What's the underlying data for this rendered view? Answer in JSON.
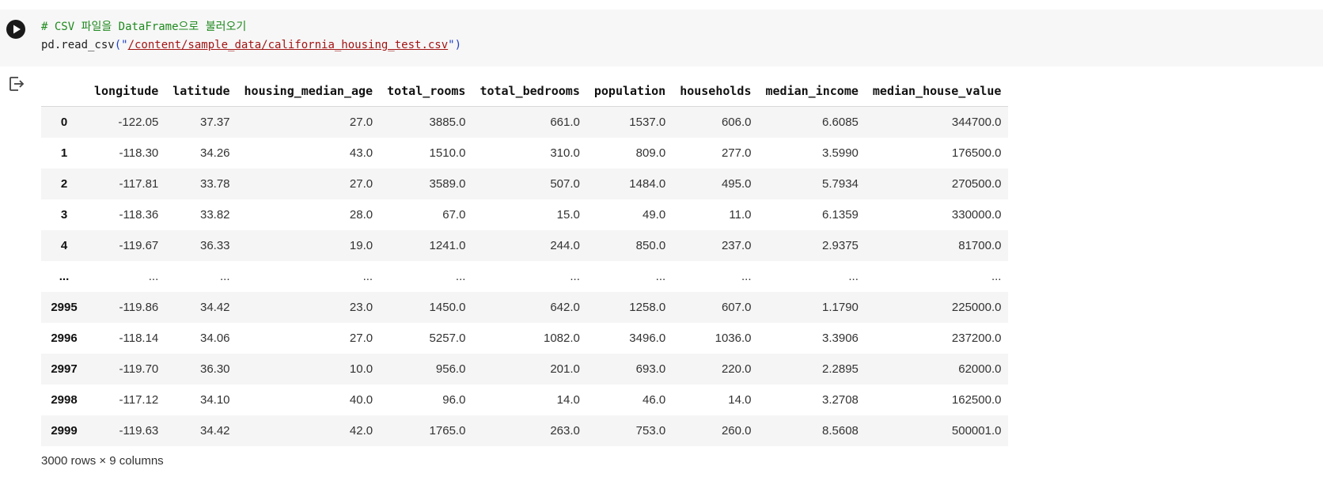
{
  "cell": {
    "code_comment": "# CSV 파일을 DataFrame으로 불러오기",
    "code_call": "pd.read_csv",
    "code_open": "(\"",
    "code_path": "/content/sample_data/california_housing_test.csv",
    "code_close": "\")",
    "run_icon": "play-icon",
    "output_icon": "output-redirect-icon"
  },
  "table": {
    "columns": [
      "longitude",
      "latitude",
      "housing_median_age",
      "total_rooms",
      "total_bedrooms",
      "population",
      "households",
      "median_income",
      "median_house_value"
    ],
    "rows": [
      {
        "index": "0",
        "values": [
          "-122.05",
          "37.37",
          "27.0",
          "3885.0",
          "661.0",
          "1537.0",
          "606.0",
          "6.6085",
          "344700.0"
        ]
      },
      {
        "index": "1",
        "values": [
          "-118.30",
          "34.26",
          "43.0",
          "1510.0",
          "310.0",
          "809.0",
          "277.0",
          "3.5990",
          "176500.0"
        ]
      },
      {
        "index": "2",
        "values": [
          "-117.81",
          "33.78",
          "27.0",
          "3589.0",
          "507.0",
          "1484.0",
          "495.0",
          "5.7934",
          "270500.0"
        ]
      },
      {
        "index": "3",
        "values": [
          "-118.36",
          "33.82",
          "28.0",
          "67.0",
          "15.0",
          "49.0",
          "11.0",
          "6.1359",
          "330000.0"
        ]
      },
      {
        "index": "4",
        "values": [
          "-119.67",
          "36.33",
          "19.0",
          "1241.0",
          "244.0",
          "850.0",
          "237.0",
          "2.9375",
          "81700.0"
        ]
      },
      {
        "index": "...",
        "values": [
          "...",
          "...",
          "...",
          "...",
          "...",
          "...",
          "...",
          "...",
          "..."
        ]
      },
      {
        "index": "2995",
        "values": [
          "-119.86",
          "34.42",
          "23.0",
          "1450.0",
          "642.0",
          "1258.0",
          "607.0",
          "1.1790",
          "225000.0"
        ]
      },
      {
        "index": "2996",
        "values": [
          "-118.14",
          "34.06",
          "27.0",
          "5257.0",
          "1082.0",
          "3496.0",
          "1036.0",
          "3.3906",
          "237200.0"
        ]
      },
      {
        "index": "2997",
        "values": [
          "-119.70",
          "36.30",
          "10.0",
          "956.0",
          "201.0",
          "693.0",
          "220.0",
          "2.2895",
          "62000.0"
        ]
      },
      {
        "index": "2998",
        "values": [
          "-117.12",
          "34.10",
          "40.0",
          "96.0",
          "14.0",
          "46.0",
          "14.0",
          "3.2708",
          "162500.0"
        ]
      },
      {
        "index": "2999",
        "values": [
          "-119.63",
          "34.42",
          "42.0",
          "1765.0",
          "263.0",
          "753.0",
          "260.0",
          "8.5608",
          "500001.0"
        ]
      }
    ],
    "shape_note": "3000 rows × 9 columns"
  }
}
